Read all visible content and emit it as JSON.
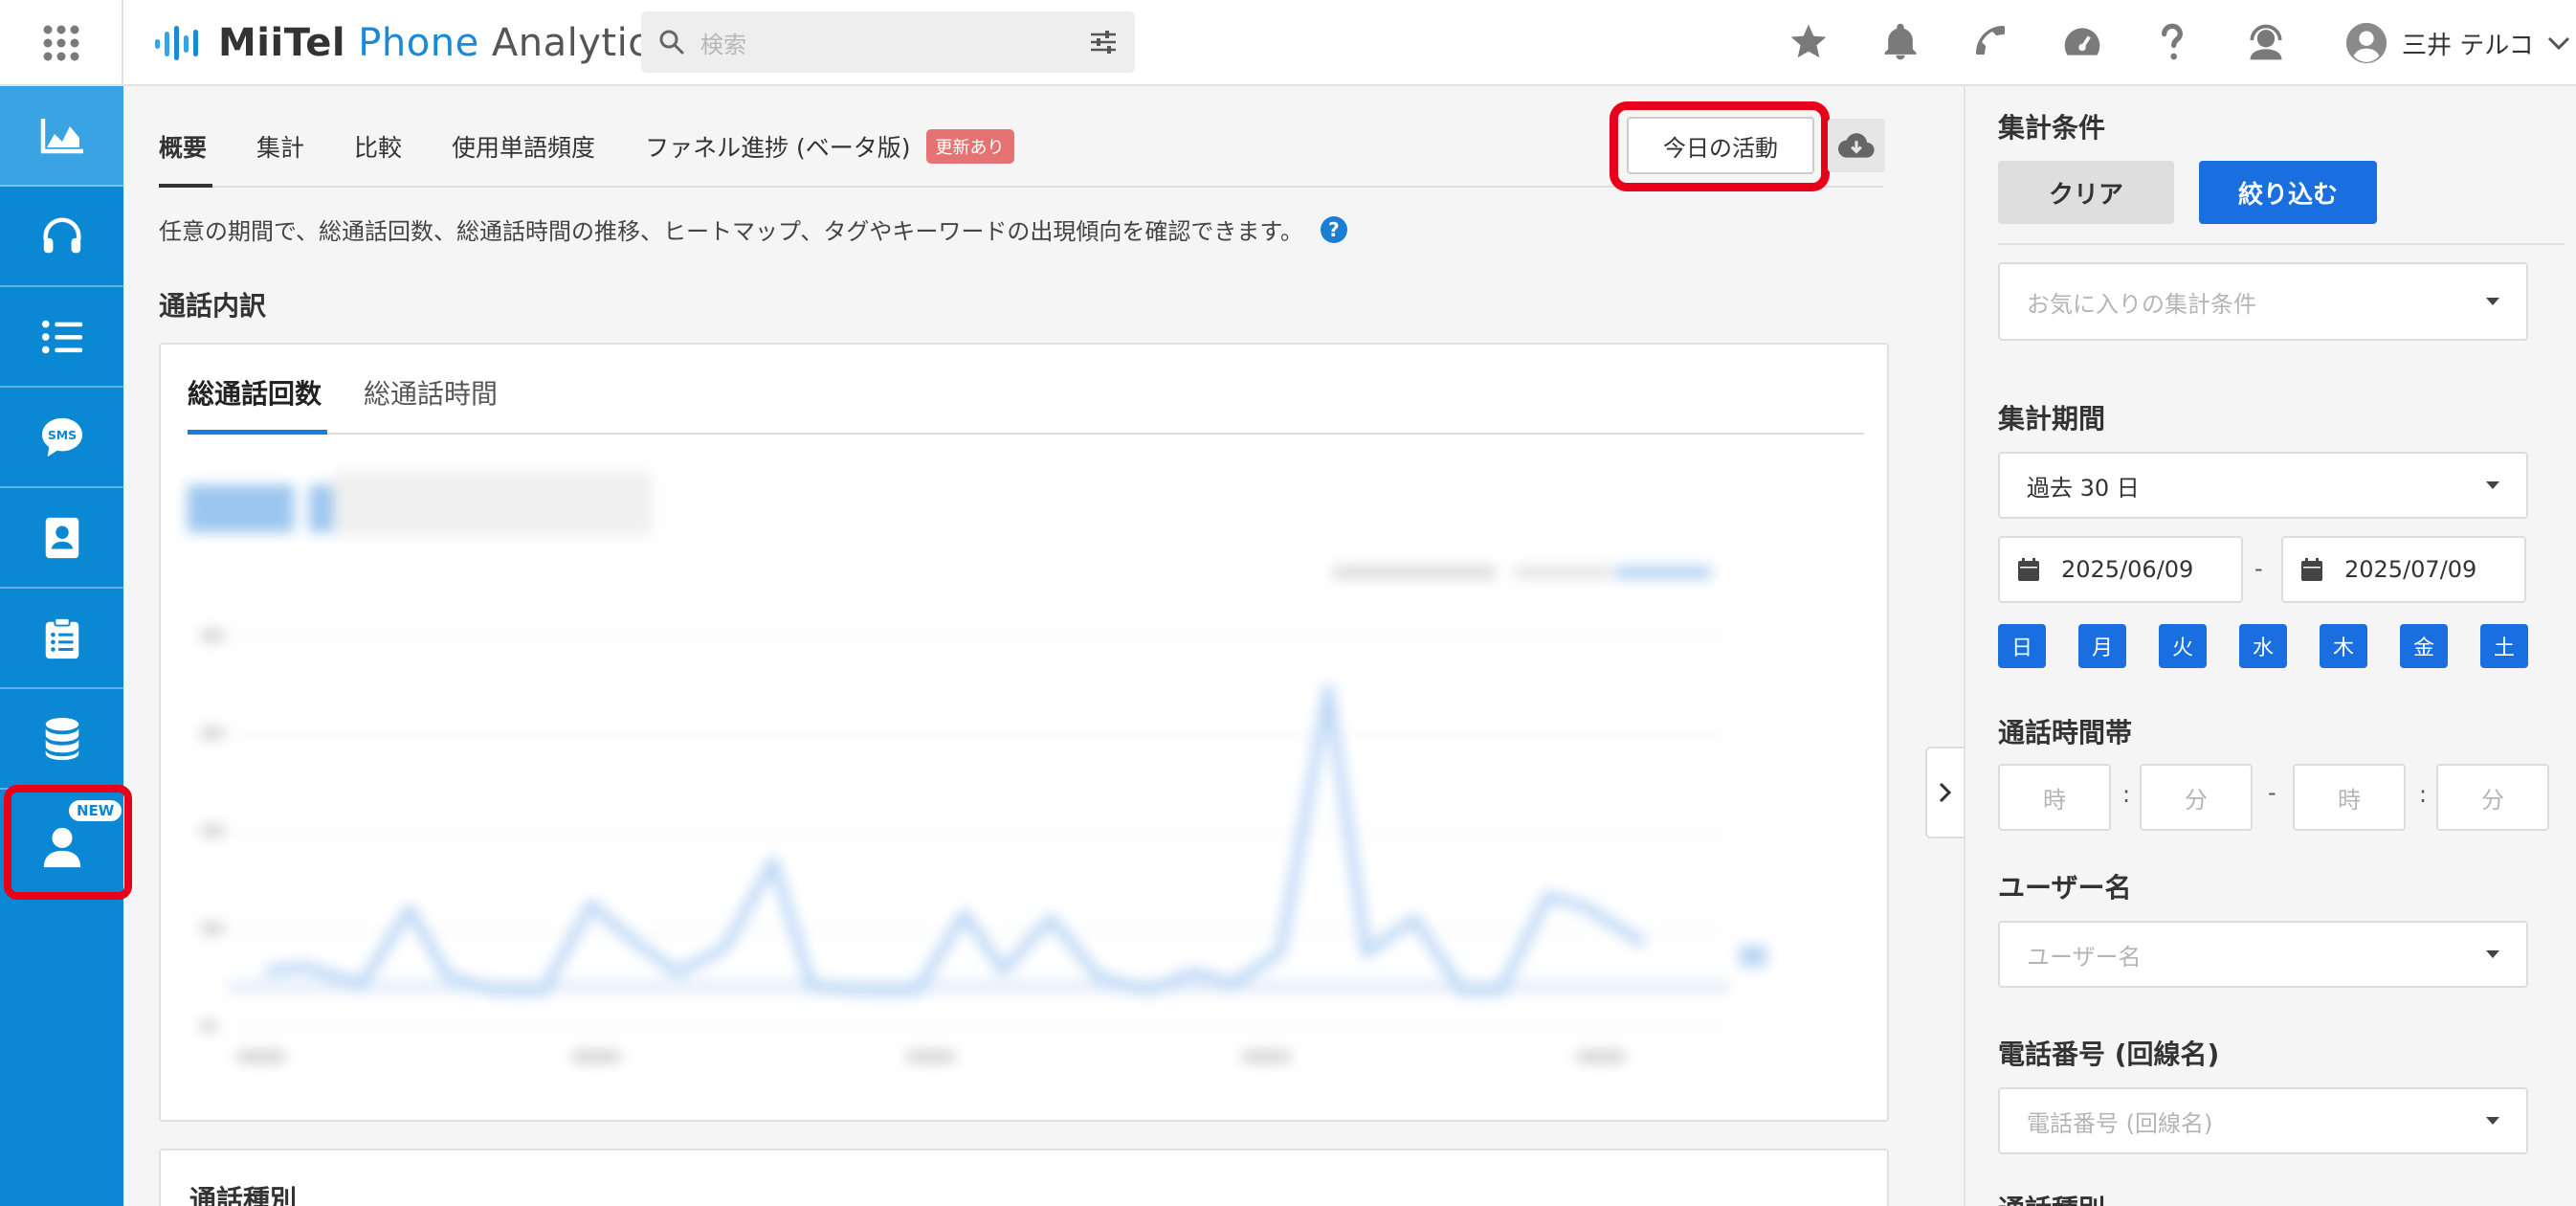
{
  "app": {
    "logo_miitel": "MiiTel",
    "logo_phone": "Phone",
    "logo_analytics": "Analytics"
  },
  "search": {
    "placeholder": "検索"
  },
  "user": {
    "name": "三井 テルコ"
  },
  "sidebar": {
    "new_badge": "NEW",
    "items": [
      "analytics-icon",
      "headset-icon",
      "list-icon",
      "sms-icon",
      "contact-card-icon",
      "clipboard-icon",
      "database-icon",
      "user-icon"
    ]
  },
  "tabs": {
    "overview": "概要",
    "aggregate": "集計",
    "compare": "比較",
    "word_freq": "使用単語頻度",
    "funnel": "ファネル進捗 (ベータ版)",
    "updated_badge": "更新あり"
  },
  "toolbar": {
    "today_button": "今日の活動"
  },
  "description": "任意の期間で、総通話回数、総通話時間の推移、ヒートマップ、タグやキーワードの出現傾向を確認できます。",
  "help": "?",
  "main": {
    "section_title": "通話内訳",
    "card_tabs": {
      "count": "総通話回数",
      "duration": "総通話時間"
    },
    "next_section_title": "通話種別"
  },
  "filter": {
    "title": "集計条件",
    "clear": "クリア",
    "apply": "絞り込む",
    "favorite_placeholder": "お気に入りの集計条件",
    "period_label": "集計期間",
    "period_value": "過去 30 日",
    "date_from": "2025/06/09",
    "date_separator": "-",
    "date_to": "2025/07/09",
    "days": [
      "日",
      "月",
      "火",
      "水",
      "木",
      "金",
      "土"
    ],
    "time_label": "通話時間帯",
    "hour_placeholder": "時",
    "minute_placeholder": "分",
    "time_colon": ":",
    "user_label": "ユーザー名",
    "user_placeholder": "ユーザー名",
    "phone_label": "電話番号 (回線名)",
    "phone_placeholder": "電話番号 (回線名)",
    "call_type_label": "通話種別"
  },
  "colors": {
    "sidebar": "#0a88d4",
    "accent": "#1a6fe0",
    "highlight": "#e8001a"
  }
}
